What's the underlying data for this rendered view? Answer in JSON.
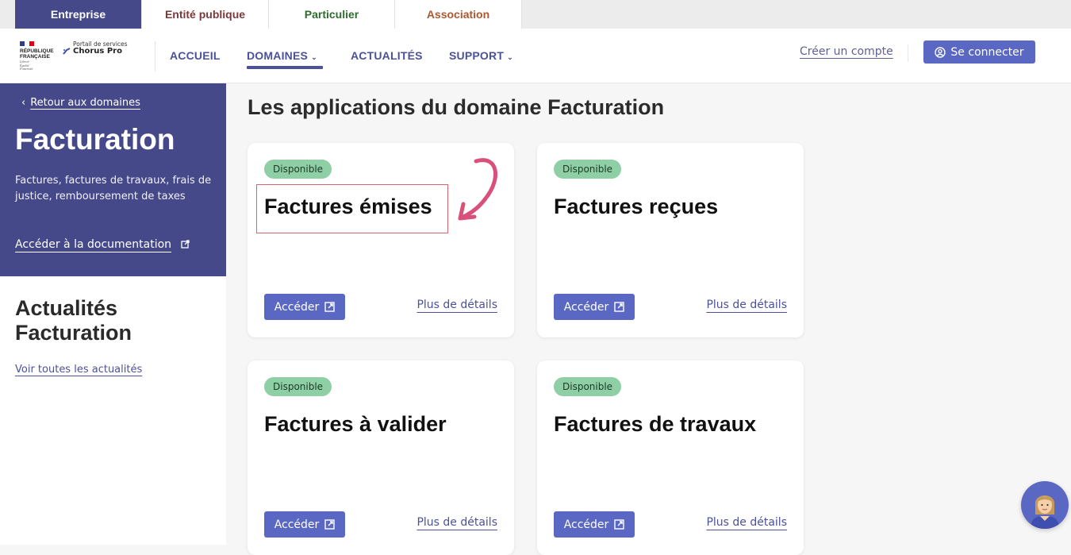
{
  "audience_tabs": [
    {
      "label": "Entreprise",
      "color": "#ffffff",
      "active": true
    },
    {
      "label": "Entité publique",
      "color": "#7a3a3a",
      "active": false
    },
    {
      "label": "Particulier",
      "color": "#2e6b2e",
      "active": false
    },
    {
      "label": "Association",
      "color": "#b0572e",
      "active": false
    }
  ],
  "logo": {
    "republic_line1": "RÉPUBLIQUE",
    "republic_line2": "FRANÇAISE",
    "motto": [
      "Liberté",
      "Égalité",
      "Fraternité"
    ],
    "portal_subtitle": "Portail de services",
    "portal_name": "Chorus Pro"
  },
  "nav": {
    "items": [
      {
        "label": "ACCUEIL",
        "has_dropdown": false
      },
      {
        "label": "DOMAINES",
        "has_dropdown": true,
        "active": true
      },
      {
        "label": "ACTUALITÉS",
        "has_dropdown": false
      },
      {
        "label": "SUPPORT",
        "has_dropdown": true
      }
    ],
    "create_account": "Créer un compte",
    "login": "Se connecter"
  },
  "sidebar": {
    "back_link": "Retour aux domaines",
    "title": "Facturation",
    "description": "Factures, factures de travaux, frais de justice, remboursement de taxes",
    "doc_link": "Accéder à la documentation",
    "news_title": "Actualités Facturation",
    "news_link": "Voir toutes les actualités"
  },
  "main": {
    "title": "Les applications du domaine Facturation",
    "cards": [
      {
        "status": "Disponible",
        "title": "Factures émises",
        "access_label": "Accéder",
        "details_label": "Plus de détails",
        "highlighted": true
      },
      {
        "status": "Disponible",
        "title": "Factures reçues",
        "access_label": "Accéder",
        "details_label": "Plus de détails"
      },
      {
        "status": "Disponible",
        "title": "Factures à valider",
        "access_label": "Accéder",
        "details_label": "Plus de détails"
      },
      {
        "status": "Disponible",
        "title": "Factures de travaux",
        "access_label": "Accéder",
        "details_label": "Plus de détails"
      }
    ]
  },
  "colors": {
    "brand": "#45498a",
    "button": "#5a68c4",
    "badge": "#8ecfa5",
    "annotation": "#d86470"
  }
}
